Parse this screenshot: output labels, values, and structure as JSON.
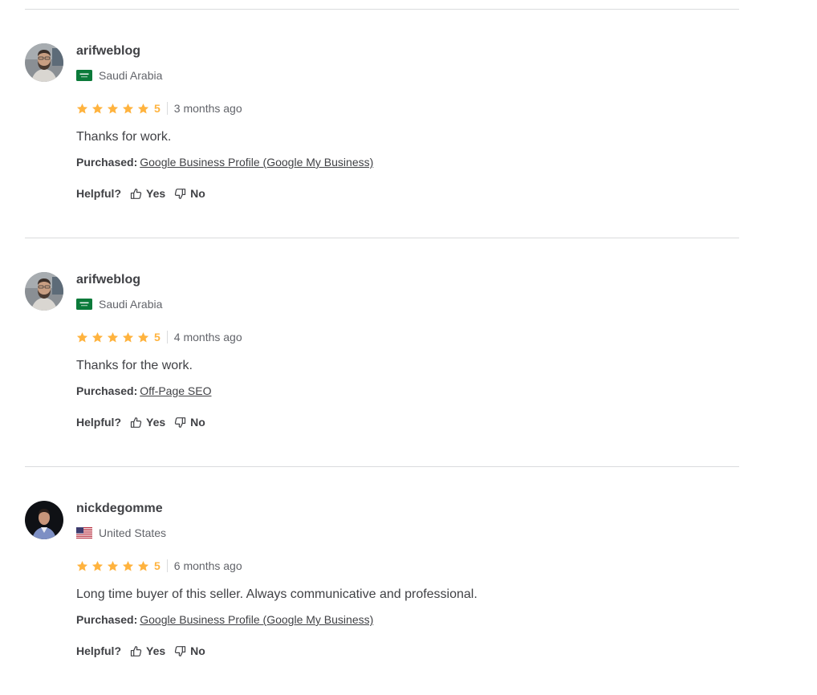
{
  "colors": {
    "star": "#ffb33e",
    "text": "#404145",
    "muted": "#62646a",
    "divider": "#dadbdd"
  },
  "labels": {
    "helpful": "Helpful?",
    "yes": "Yes",
    "no": "No",
    "purchased": "Purchased:"
  },
  "reviews": [
    {
      "username": "arifweblog",
      "country": "Saudi Arabia",
      "flag": "saudi-arabia-flag-icon",
      "rating": 5,
      "score": "5",
      "date": "3 months ago",
      "text": "Thanks for work.",
      "purchased": "Google Business Profile (Google My Business)"
    },
    {
      "username": "arifweblog",
      "country": "Saudi Arabia",
      "flag": "saudi-arabia-flag-icon",
      "rating": 5,
      "score": "5",
      "date": "4 months ago",
      "text": "Thanks for the work.",
      "purchased": "Off-Page SEO"
    },
    {
      "username": "nickdegomme",
      "country": "United States",
      "flag": "united-states-flag-icon",
      "rating": 5,
      "score": "5",
      "date": "6 months ago",
      "text": "Long time buyer of this seller. Always communicative and professional.",
      "purchased": "Google Business Profile (Google My Business)"
    }
  ]
}
